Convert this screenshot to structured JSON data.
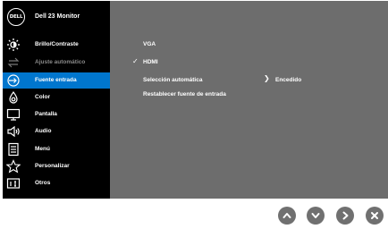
{
  "header": {
    "logo_text": "DELL",
    "title": "Dell 23 Monitor"
  },
  "menu": [
    {
      "label": "Brillo/Contraste",
      "icon": "brightness-icon",
      "state": "normal"
    },
    {
      "label": "Ajuste automático",
      "icon": "auto-adjust-icon",
      "state": "disabled"
    },
    {
      "label": "Fuente entrada",
      "icon": "input-source-icon",
      "state": "active"
    },
    {
      "label": "Color",
      "icon": "color-icon",
      "state": "normal"
    },
    {
      "label": "Pantalla",
      "icon": "display-icon",
      "state": "normal"
    },
    {
      "label": "Audio",
      "icon": "audio-icon",
      "state": "normal"
    },
    {
      "label": "Menú",
      "icon": "menu-icon",
      "state": "normal"
    },
    {
      "label": "Personalizar",
      "icon": "star-icon",
      "state": "normal"
    },
    {
      "label": "Otros",
      "icon": "others-icon",
      "state": "normal"
    }
  ],
  "panel": {
    "options": [
      {
        "label": "VGA",
        "checked": false
      },
      {
        "label": "HDMI",
        "checked": true
      },
      {
        "label": "Selección automática",
        "value": "Encedido"
      },
      {
        "label": "Restablecer fuente de entrada"
      }
    ]
  },
  "nav_buttons": [
    "up-button",
    "down-button",
    "right-button",
    "exit-button"
  ],
  "colors": {
    "active": "#0076ce",
    "panel": "#6d6d6d",
    "sidebar": "#000000",
    "button": "#707070"
  }
}
